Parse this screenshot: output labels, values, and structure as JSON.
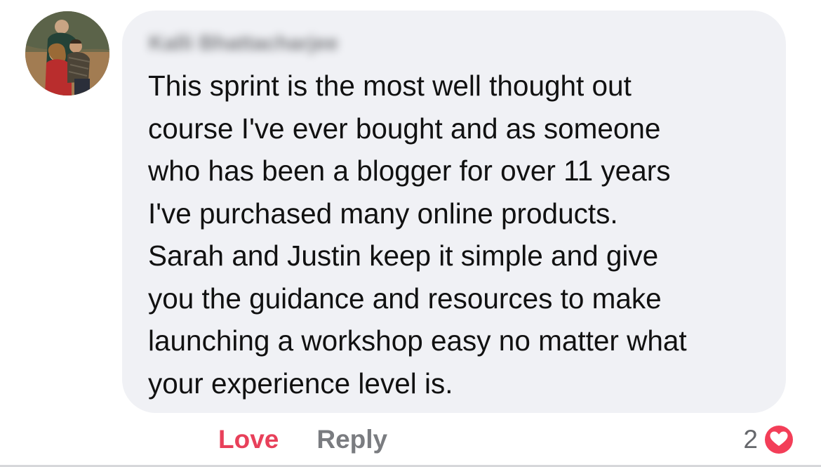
{
  "comment": {
    "author_name": "Kalli Bhattacharjee",
    "text": "This sprint is the most well thought out\ncourse I've ever bought and as someone\nwho has been a blogger for over 11 years\nI've purchased many online products.\nSarah and Justin keep it simple and give\nyou the guidance and resources to make\nlaunching a workshop easy no matter what\nyour experience level is."
  },
  "actions": {
    "love_label": "Love",
    "reply_label": "Reply"
  },
  "reactions": {
    "count": "2",
    "icon": "heart-reaction-icon"
  },
  "colors": {
    "bubble_background": "#f0f1f5",
    "love_active": "#e8405a",
    "reply_gray": "#7a7c80",
    "heart_badge": "#f33e58"
  }
}
